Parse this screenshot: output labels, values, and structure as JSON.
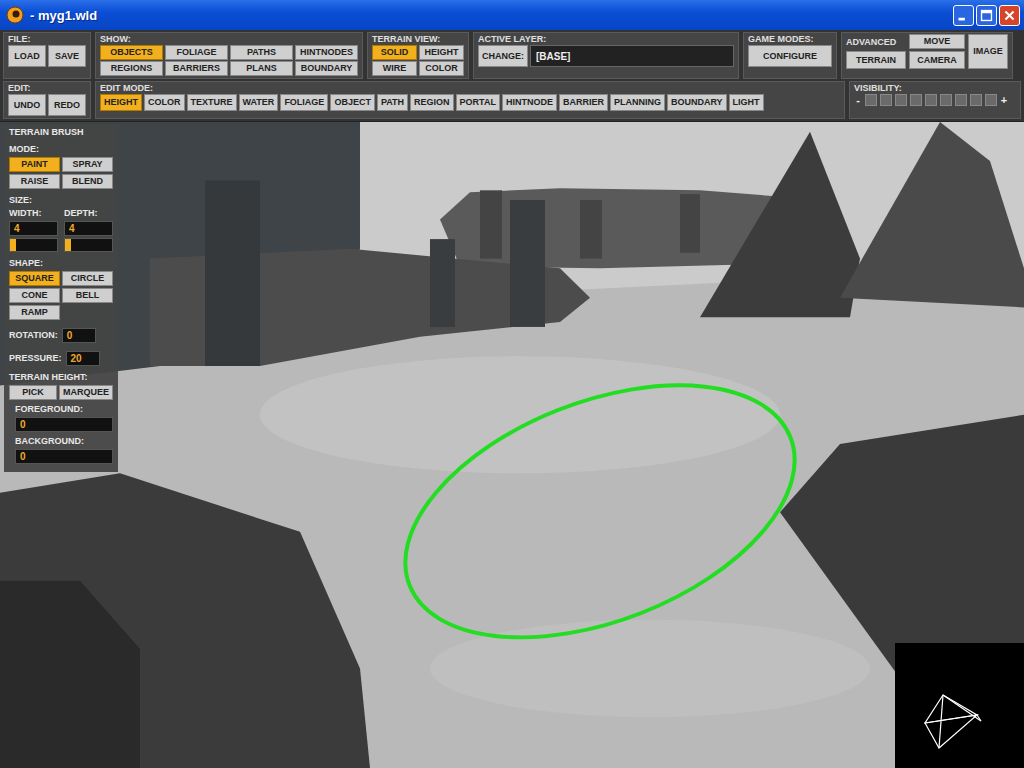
{
  "window": {
    "title": "- myg1.wld"
  },
  "toolbar": {
    "rows": [
      {
        "groups": [
          {
            "kind": "pair",
            "label": "FILE:",
            "buttons": [
              {
                "label": "LOAD",
                "selected": false
              },
              {
                "label": "SAVE",
                "selected": false
              }
            ]
          },
          {
            "kind": "grid",
            "label": "SHOW:",
            "buttons": [
              {
                "label": "OBJECTS",
                "selected": true
              },
              {
                "label": "FOLIAGE",
                "selected": false
              },
              {
                "label": "PATHS",
                "selected": false
              },
              {
                "label": "HINTNODES",
                "selected": false
              },
              {
                "label": "REGIONS",
                "selected": false
              },
              {
                "label": "BARRIERS",
                "selected": false
              },
              {
                "label": "PLANS",
                "selected": false
              },
              {
                "label": "BOUNDARY",
                "selected": false
              }
            ]
          },
          {
            "kind": "grid2",
            "label": "TERRAIN VIEW:",
            "buttons": [
              {
                "label": "SOLID",
                "selected": true
              },
              {
                "label": "HEIGHT",
                "selected": false
              },
              {
                "label": "WIRE",
                "selected": false
              },
              {
                "label": "COLOR",
                "selected": false
              }
            ]
          },
          {
            "kind": "layer",
            "label": "ACTIVE LAYER:",
            "buttons": [
              {
                "label": "CHANGE:",
                "selected": false
              }
            ],
            "value": "[BASE]"
          },
          {
            "kind": "single",
            "label": "GAME MODES:",
            "buttons": [
              {
                "label": "CONFIGURE",
                "selected": false
              }
            ]
          },
          {
            "kind": "advanced",
            "label": "ADVANCED",
            "buttons": [
              {
                "label": "MOVE",
                "selected": false
              },
              {
                "label": "TERRAIN",
                "selected": false
              },
              {
                "label": "CAMERA",
                "selected": false
              },
              {
                "label": "IMAGE",
                "selected": false
              }
            ]
          }
        ]
      },
      {
        "groups": [
          {
            "kind": "pair",
            "label": "EDIT:",
            "buttons": [
              {
                "label": "UNDO",
                "selected": false
              },
              {
                "label": "REDO",
                "selected": false
              }
            ]
          },
          {
            "kind": "strip",
            "label": "EDIT MODE:",
            "buttons": [
              {
                "label": "HEIGHT",
                "selected": true
              },
              {
                "label": "COLOR",
                "selected": false
              },
              {
                "label": "TEXTURE",
                "selected": false
              },
              {
                "label": "WATER",
                "selected": false
              },
              {
                "label": "FOLIAGE",
                "selected": false
              },
              {
                "label": "OBJECT",
                "selected": false
              },
              {
                "label": "PATH",
                "selected": false
              },
              {
                "label": "REGION",
                "selected": false
              },
              {
                "label": "PORTAL",
                "selected": false
              },
              {
                "label": "HINTNODE",
                "selected": false
              },
              {
                "label": "BARRIER",
                "selected": false
              },
              {
                "label": "PLANNING",
                "selected": false
              },
              {
                "label": "BOUNDARY",
                "selected": false
              },
              {
                "label": "LIGHT",
                "selected": false
              }
            ]
          },
          {
            "kind": "visibility",
            "label": "VISIBILITY:",
            "minus": "-",
            "plus": "+",
            "cells": [
              {
                "on": false
              },
              {
                "on": false
              },
              {
                "on": false
              },
              {
                "on": false
              },
              {
                "on": false
              },
              {
                "on": false
              },
              {
                "on": false
              },
              {
                "on": false
              },
              {
                "on": false
              }
            ]
          }
        ]
      }
    ]
  },
  "brush_panel": {
    "title": "TERRAIN BRUSH",
    "mode": {
      "label": "MODE:",
      "buttons": [
        {
          "label": "PAINT",
          "selected": true
        },
        {
          "label": "SPRAY",
          "selected": false
        },
        {
          "label": "RAISE",
          "selected": false
        },
        {
          "label": "BLEND",
          "selected": false
        }
      ]
    },
    "size": {
      "label": "SIZE:",
      "fields": [
        {
          "label": "WIDTH:",
          "value": "4",
          "level": 0.12
        },
        {
          "label": "DEPTH:",
          "value": "4",
          "level": 0.12
        }
      ]
    },
    "shape": {
      "label": "SHAPE:",
      "buttons": [
        {
          "label": "SQUARE",
          "selected": true
        },
        {
          "label": "CIRCLE",
          "selected": false
        },
        {
          "label": "CONE",
          "selected": false
        },
        {
          "label": "BELL",
          "selected": false
        },
        {
          "label": "RAMP",
          "selected": false
        }
      ]
    },
    "params": [
      {
        "label": "ROTATION:",
        "value": "0"
      },
      {
        "label": "PRESSURE:",
        "value": "20"
      }
    ],
    "terrain_height": {
      "label": "TERRAIN HEIGHT:",
      "buttons": [
        {
          "label": "PICK",
          "selected": false
        },
        {
          "label": "MARQUEE",
          "selected": false
        }
      ]
    },
    "heights": [
      {
        "label": "FOREGROUND:",
        "value": "0"
      },
      {
        "label": "BACKGROUND:",
        "value": "0"
      }
    ]
  }
}
